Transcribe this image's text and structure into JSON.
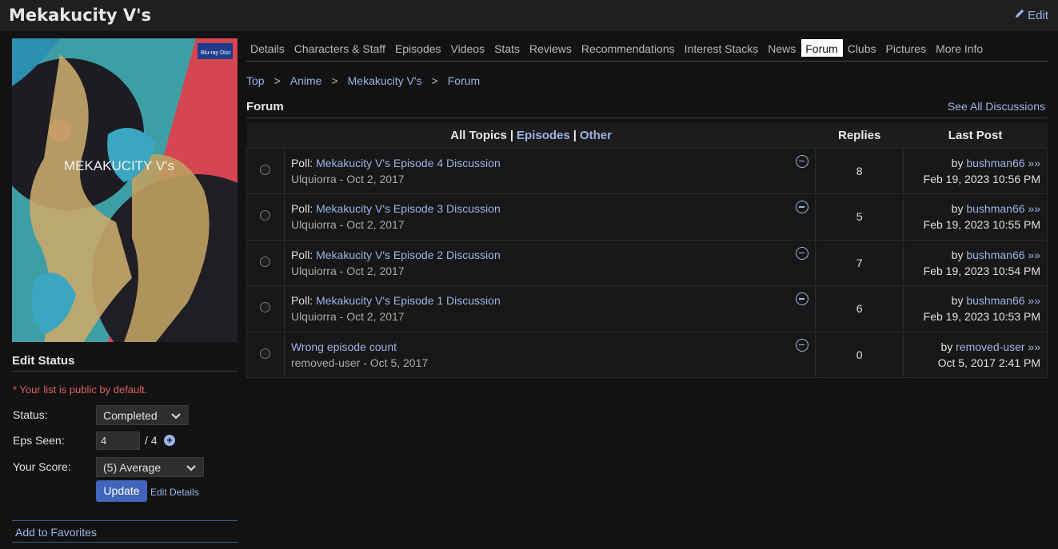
{
  "header": {
    "title": "Mekakucity V's",
    "edit_label": "Edit"
  },
  "cover": {
    "logo_text": "MEKAKUCITY V's",
    "badge_text": "Blu-ray Disc"
  },
  "sidebar": {
    "edit_status_title": "Edit Status",
    "public_note": "* Your list is public by default.",
    "status_label": "Status:",
    "status_value": "Completed",
    "eps_label": "Eps Seen:",
    "eps_value": "4",
    "eps_total": "/ 4",
    "score_label": "Your Score:",
    "score_value": "(5) Average",
    "update_label": "Update",
    "edit_details_label": "Edit Details",
    "favorites_label": "Add to Favorites"
  },
  "tabs": [
    "Details",
    "Characters & Staff",
    "Episodes",
    "Videos",
    "Stats",
    "Reviews",
    "Recommendations",
    "Interest Stacks",
    "News",
    "Forum",
    "Clubs",
    "Pictures",
    "More Info"
  ],
  "active_tab": "Forum",
  "breadcrumb": [
    "Top",
    "Anime",
    "Mekakucity V's",
    "Forum"
  ],
  "forum": {
    "title": "Forum",
    "see_all": "See All Discussions",
    "col_all_topics": "All Topics",
    "col_episodes": "Episodes",
    "col_other": "Other",
    "col_replies": "Replies",
    "col_last_post": "Last Post",
    "topics": [
      {
        "prefix": "Poll: ",
        "title": "Mekakucity V's Episode 4 Discussion",
        "author": "Ulquiorra",
        "date": "Oct 2, 2017",
        "replies": "8",
        "last_by": "bushman66",
        "last_date": "Feb 19, 2023 10:56 PM"
      },
      {
        "prefix": "Poll: ",
        "title": "Mekakucity V's Episode 3 Discussion",
        "author": "Ulquiorra",
        "date": "Oct 2, 2017",
        "replies": "5",
        "last_by": "bushman66",
        "last_date": "Feb 19, 2023 10:55 PM"
      },
      {
        "prefix": "Poll: ",
        "title": "Mekakucity V's Episode 2 Discussion",
        "author": "Ulquiorra",
        "date": "Oct 2, 2017",
        "replies": "7",
        "last_by": "bushman66",
        "last_date": "Feb 19, 2023 10:54 PM"
      },
      {
        "prefix": "Poll: ",
        "title": "Mekakucity V's Episode 1 Discussion",
        "author": "Ulquiorra",
        "date": "Oct 2, 2017",
        "replies": "6",
        "last_by": "bushman66",
        "last_date": "Feb 19, 2023 10:53 PM"
      },
      {
        "prefix": "",
        "title": "Wrong episode count",
        "author": "removed-user",
        "date": "Oct 5, 2017",
        "replies": "0",
        "last_by": "removed-user",
        "last_date": "Oct 5, 2017 2:41 PM"
      }
    ]
  },
  "colors": {
    "background": "#121212",
    "link": "#9ab4e8",
    "accent_button": "#4065ba",
    "note": "#e06060"
  }
}
